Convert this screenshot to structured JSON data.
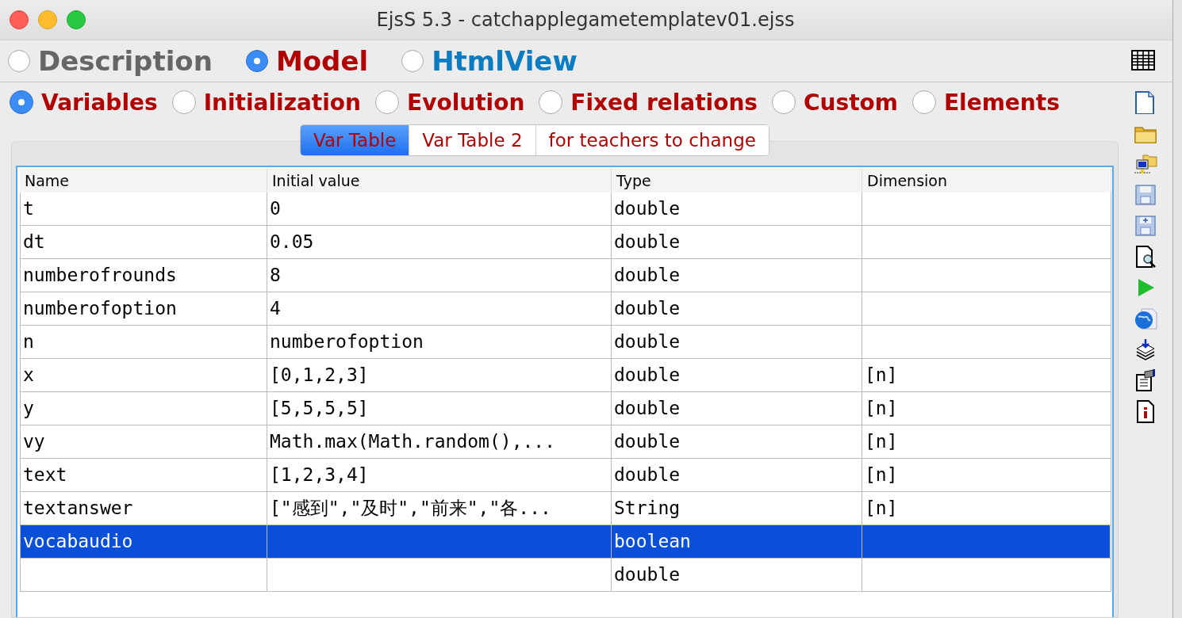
{
  "window": {
    "title": "EjsS 5.3 - catchapplegametemplatev01.ejss"
  },
  "main_tabs": [
    {
      "label": "Description",
      "selected": false,
      "color": "#666666"
    },
    {
      "label": "Model",
      "selected": true,
      "color": "#b00000"
    },
    {
      "label": "HtmlView",
      "selected": false,
      "color": "#0a7cc2"
    }
  ],
  "model_tabs": [
    {
      "label": "Variables",
      "selected": true
    },
    {
      "label": "Initialization",
      "selected": false
    },
    {
      "label": "Evolution",
      "selected": false
    },
    {
      "label": "Fixed relations",
      "selected": false
    },
    {
      "label": "Custom",
      "selected": false
    },
    {
      "label": "Elements",
      "selected": false
    }
  ],
  "page_tabs": [
    {
      "label": "Var Table",
      "selected": true
    },
    {
      "label": "Var Table 2",
      "selected": false
    },
    {
      "label": "for teachers to change",
      "selected": false
    }
  ],
  "table": {
    "columns": [
      "Name",
      "Initial value",
      "Type",
      "Dimension"
    ],
    "rows": [
      {
        "name": "t",
        "initial_value": "0",
        "type": "double",
        "selected": false
      },
      {
        "name": "dt",
        "initial_value": "0.05",
        "type": "double",
        "selected": false
      },
      {
        "name": "numberofrounds",
        "initial_value": "8",
        "type": "double",
        "selected": false
      },
      {
        "name": "numberofoption",
        "initial_value": "4",
        "type": "double",
        "selected": false
      },
      {
        "name": "n",
        "initial_value": "numberofoption",
        "type": "double",
        "selected": false
      },
      {
        "name": "x",
        "initial_value": "[0,1,2,3]",
        "type": "double",
        "dimension": "[n]",
        "selected": false
      },
      {
        "name": "y",
        "initial_value": "[5,5,5,5]",
        "type": "double",
        "dimension": "[n]",
        "selected": false
      },
      {
        "name": "vy",
        "initial_value": "Math.max(Math.random(),...",
        "type": "double",
        "dimension": "[n]",
        "selected": false
      },
      {
        "name": "text",
        "initial_value": "[1,2,3,4]",
        "type": "double",
        "dimension": "[n]",
        "selected": false
      },
      {
        "name": "textanswer",
        "initial_value": "[\"感到\",\"及时\",\"前来\",\"各...",
        "type": "String",
        "dimension": "[n]",
        "selected": false
      },
      {
        "name": "vocabaudio",
        "type": "boolean",
        "selected": true
      },
      {
        "type": "double",
        "selected": false
      }
    ]
  }
}
